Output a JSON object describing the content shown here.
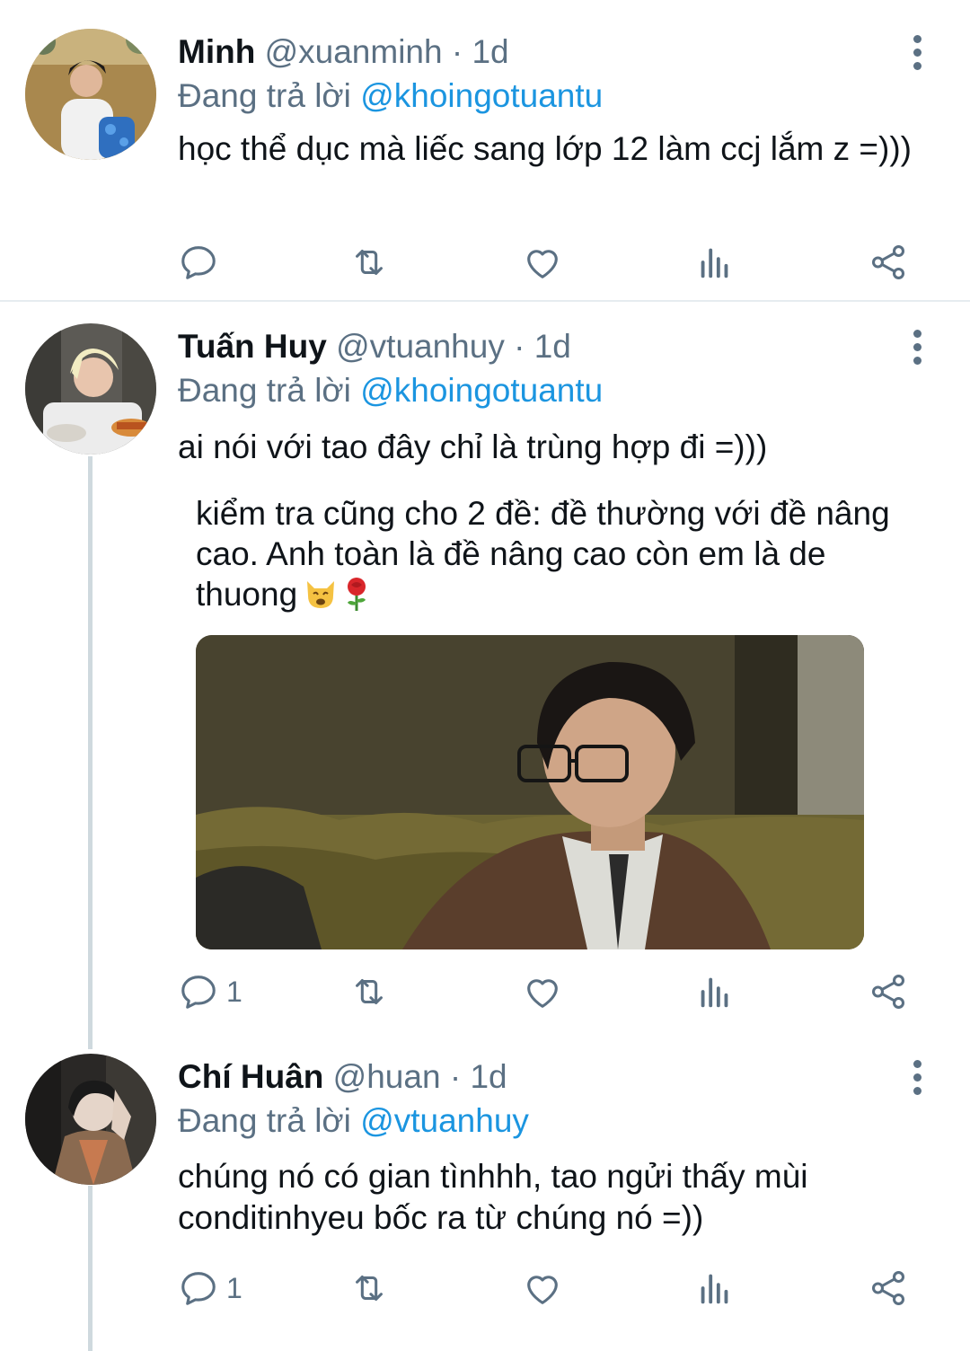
{
  "tweets": [
    {
      "name": "Minh",
      "handle": "@xuanminh",
      "dot": "·",
      "time": "1d",
      "reply_prefix": "Đang trả lời",
      "reply_to": "@khoingotuantu",
      "text": "học thể dục mà liếc sang lớp 12 làm ccj lắm z =)))",
      "reply_count": "",
      "icons": [
        "reply-icon",
        "retweet-icon",
        "like-icon",
        "analytics-icon",
        "share-icon"
      ]
    },
    {
      "name": "Tuấn Huy",
      "handle": "@vtuanhuy",
      "dot": "·",
      "time": "1d",
      "reply_prefix": "Đang trả lời",
      "reply_to": "@khoingotuantu",
      "text": "ai nói với tao đây chỉ là trùng hợp đi =)))",
      "quote": "kiểm tra cũng cho 2 đề: đề thường với đề nâng cao. Anh toàn là đề nâng cao còn em là de thuong",
      "reply_count": "1",
      "icons": [
        "reply-icon",
        "retweet-icon",
        "like-icon",
        "analytics-icon",
        "share-icon"
      ]
    },
    {
      "name": "Chí Huân",
      "handle": "@huan",
      "dot": "·",
      "time": "1d",
      "reply_prefix": "Đang trả lời",
      "reply_to": "@vtuanhuy",
      "text": "chúng nó có gian tìnhhh, tao ngửi thấy mùi conditinhyeu bốc ra từ chúng nó =))",
      "reply_count": "1",
      "icons": [
        "reply-icon",
        "retweet-icon",
        "like-icon",
        "analytics-icon",
        "share-icon"
      ]
    }
  ],
  "colors": {
    "text": "#0f1419",
    "secondary": "#5b7083",
    "link": "#1b95e0",
    "divider": "#e6ecf0",
    "thread_line": "#cfd9de"
  }
}
